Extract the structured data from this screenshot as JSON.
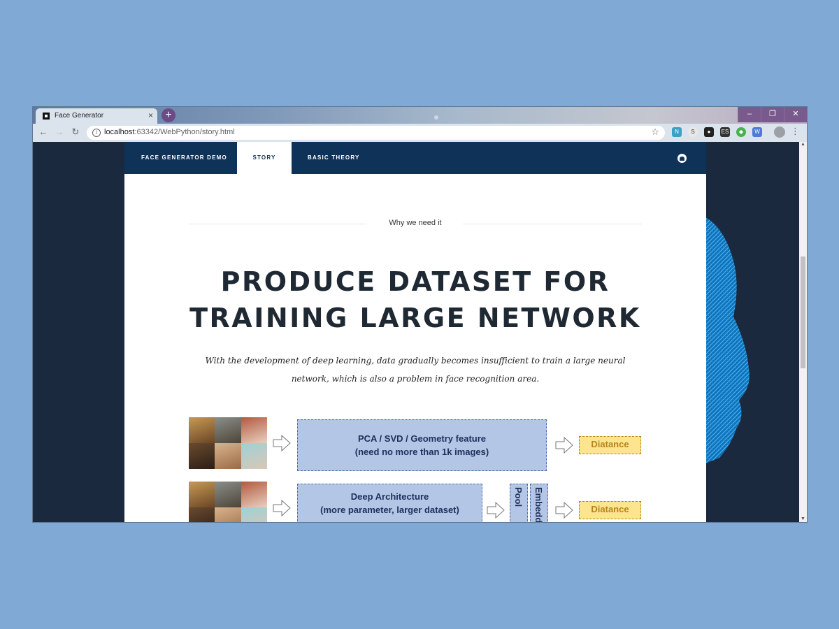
{
  "browser": {
    "tab_title": "Face Generator",
    "tab_close": "×",
    "new_tab": "+",
    "url_host": "localhost",
    "url_rest": ":63342/WebPython/story.html",
    "window_controls": [
      "–",
      "❐",
      "✕"
    ]
  },
  "nav": {
    "items": [
      "FACE GENERATOR DEMO",
      "STORY",
      "BASIC THEORY"
    ],
    "active": "STORY"
  },
  "section": {
    "label": "Why we need it",
    "headline_line1": "PRODUCE DATASET FOR",
    "headline_line2": "TRAINING LARGE NETWORK",
    "lead": "With the development of deep learning, data gradually becomes insufficient to train a large neural network, which is also a problem in face recognition area."
  },
  "diagram": {
    "row1_box_line1": "PCA / SVD / Geometry feature",
    "row1_box_line2": "(need no more than 1k images)",
    "row1_output": "Diatance",
    "row2_box_line1": "Deep Architecture",
    "row2_box_line2": "(more parameter, larger dataset)",
    "row2_pool": "Pool",
    "row2_embed": "Embedding",
    "row2_output": "Diatance"
  },
  "colors": {
    "nav_bg": "#0f3258",
    "diagram_box": "#b3c6e6",
    "output_box": "#fde48e",
    "page_bg": "#80a9d6"
  }
}
